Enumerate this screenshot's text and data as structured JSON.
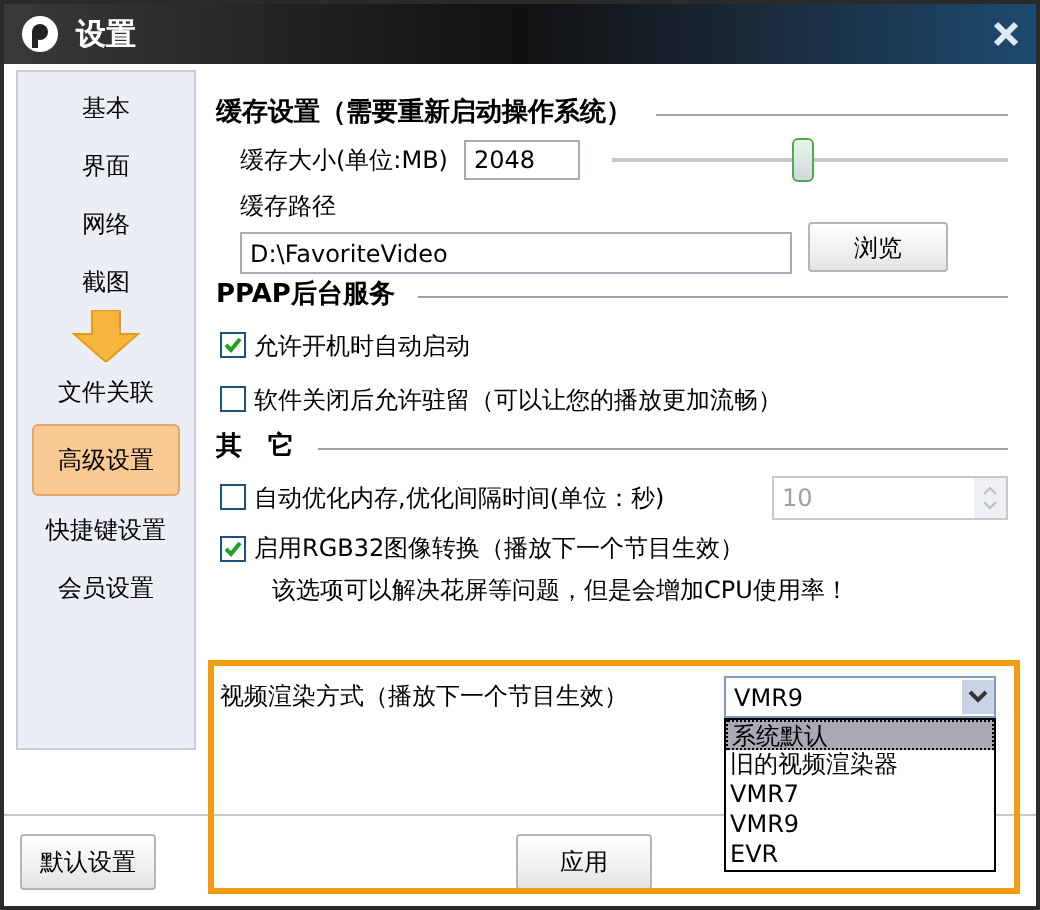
{
  "window": {
    "title": "设置"
  },
  "sidebar": {
    "items": [
      {
        "label": "基本",
        "selected": false
      },
      {
        "label": "界面",
        "selected": false
      },
      {
        "label": "网络",
        "selected": false
      },
      {
        "label": "截图",
        "selected": false
      },
      {
        "label": "文件关联",
        "selected": false
      },
      {
        "label": "高级设置",
        "selected": true
      },
      {
        "label": "快捷键设置",
        "selected": false
      },
      {
        "label": "会员设置",
        "selected": false
      }
    ]
  },
  "cache": {
    "heading": "缓存设置（需要重新启动操作系统）",
    "size_label": "缓存大小(单位:MB)",
    "size_value": "2048",
    "level": 0.48,
    "path_label": "缓存路径",
    "path_value": "D:\\FavoriteVideo",
    "browse": "浏览"
  },
  "service": {
    "heading": "PPAP后台服务",
    "options": [
      {
        "label": "允许开机时自动启动",
        "checked": true
      },
      {
        "label": "软件关闭后允许驻留（可以让您的播放更加流畅）",
        "checked": false
      }
    ]
  },
  "other": {
    "heading": "其　它",
    "memory": {
      "label": "自动优化内存,优化间隔时间(单位：秒)",
      "checked": false,
      "value": "10",
      "disabled": true
    },
    "rgb": {
      "label": "启用RGB32图像转换（播放下一个节目生效）",
      "checked": true,
      "note": "该选项可以解决花屏等问题，但是会增加CPU使用率！"
    }
  },
  "render": {
    "label": "视频渲染方式（播放下一个节目生效）",
    "value": "VMR9",
    "options": [
      {
        "label": "系统默认",
        "highlighted": true
      },
      {
        "label": "旧的视频渲染器",
        "highlighted": false
      },
      {
        "label": "VMR7",
        "highlighted": false
      },
      {
        "label": "VMR9",
        "highlighted": false
      },
      {
        "label": "EVR",
        "highlighted": false
      }
    ]
  },
  "footer": {
    "default_button": "默认设置",
    "apply_button": "应用"
  }
}
